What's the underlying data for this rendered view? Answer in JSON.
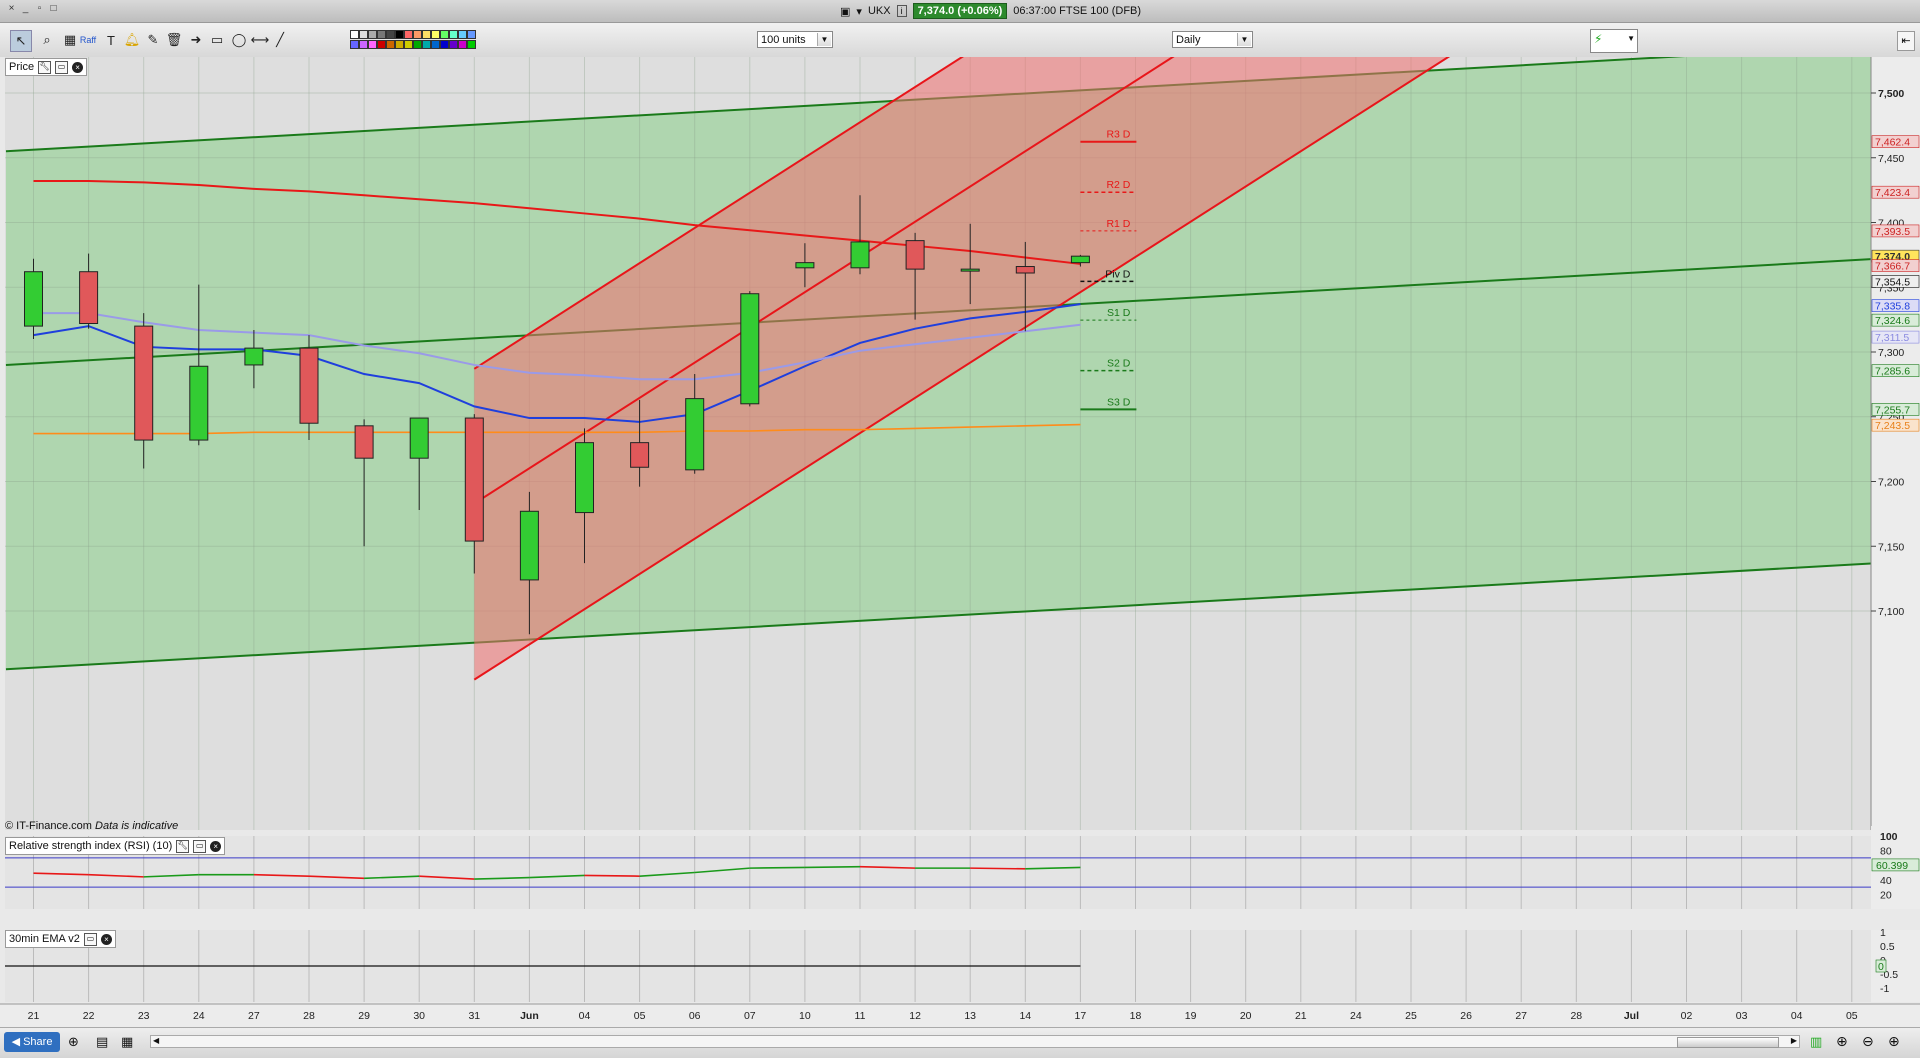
{
  "window": {
    "symbol": "UKX",
    "quote": "7,374.0 (+0.06%)",
    "time_instrument": "06:37:00 FTSE 100 (DFB)"
  },
  "toolbar": {
    "units_select": "100 units",
    "interval_select": "Daily"
  },
  "panels": {
    "price_label": "Price",
    "rsi_label": "Relative strength index (RSI) (10)",
    "ema_label": "30min EMA v2",
    "copyright": "© IT-Finance.com",
    "disclaimer": "Data is indicative"
  },
  "bottom": {
    "share_label": "Share"
  },
  "colors": {
    "bull": "#33cc33",
    "bear": "#e0585a",
    "channel_red": "#e8151a",
    "channel_green": "#1a7a1a",
    "sma_red": "#e81818",
    "ma_blue": "#1f3fdd",
    "ma_lavender": "#9a9ae8",
    "ma_orange": "#ff8c1a"
  },
  "chart_data": {
    "type": "candlestick",
    "x_labels": [
      "21",
      "22",
      "23",
      "24",
      "27",
      "28",
      "29",
      "30",
      "31",
      "Jun",
      "04",
      "05",
      "06",
      "07",
      "10",
      "11",
      "12",
      "13",
      "14",
      "17",
      "18",
      "19",
      "20",
      "21",
      "24",
      "25",
      "26",
      "27",
      "28",
      "Jul",
      "02",
      "03",
      "04",
      "05"
    ],
    "y_ticks": [
      7100,
      7150,
      7200,
      7250,
      7300,
      7350,
      7400,
      7450,
      7500
    ],
    "ylim": [
      7040,
      7535
    ],
    "candles": [
      {
        "o": 7320,
        "h": 7372,
        "l": 7310,
        "c": 7362
      },
      {
        "o": 7362,
        "h": 7376,
        "l": 7318,
        "c": 7322
      },
      {
        "o": 7320,
        "h": 7330,
        "l": 7210,
        "c": 7232
      },
      {
        "o": 7232,
        "h": 7352,
        "l": 7228,
        "c": 7289
      },
      {
        "o": 7290,
        "h": 7317,
        "l": 7272,
        "c": 7303
      },
      {
        "o": 7303,
        "h": 7313,
        "l": 7232,
        "c": 7245
      },
      {
        "o": 7243,
        "h": 7248,
        "l": 7150,
        "c": 7218
      },
      {
        "o": 7218,
        "h": 7233,
        "l": 7178,
        "c": 7249
      },
      {
        "o": 7249,
        "h": 7252,
        "l": 7129,
        "c": 7154
      },
      {
        "o": 7124,
        "h": 7192,
        "l": 7082,
        "c": 7177
      },
      {
        "o": 7176,
        "h": 7241,
        "l": 7137,
        "c": 7230
      },
      {
        "o": 7230,
        "h": 7263,
        "l": 7196,
        "c": 7211
      },
      {
        "o": 7209,
        "h": 7283,
        "l": 7206,
        "c": 7264
      },
      {
        "o": 7260,
        "h": 7347,
        "l": 7258,
        "c": 7345
      },
      {
        "o": 7365,
        "h": 7384,
        "l": 7350,
        "c": 7369
      },
      {
        "o": 7365,
        "h": 7421,
        "l": 7360,
        "c": 7385
      },
      {
        "o": 7386,
        "h": 7392,
        "l": 7325,
        "c": 7364
      },
      {
        "o": 7364,
        "h": 7399,
        "l": 7337,
        "c": 7364
      },
      {
        "o": 7366,
        "h": 7385,
        "l": 7316,
        "c": 7361
      },
      {
        "o": 7369,
        "h": 7375,
        "l": 7366,
        "c": 7374
      }
    ],
    "lines": [
      {
        "name": "sma_red",
        "values": [
          7432,
          7432,
          7431,
          7429,
          7426,
          7424,
          7421,
          7418,
          7415,
          7411,
          7407,
          7403,
          7398,
          7394,
          7390,
          7386,
          7382,
          7378,
          7373,
          7368
        ]
      },
      {
        "name": "ma_blue",
        "values": [
          7313,
          7320,
          7304,
          7302,
          7302,
          7297,
          7283,
          7276,
          7258,
          7249,
          7249,
          7246,
          7252,
          7270,
          7289,
          7307,
          7318,
          7326,
          7331,
          7337
        ]
      },
      {
        "name": "ma_lavender",
        "values": [
          7330,
          7330,
          7323,
          7317,
          7315,
          7313,
          7305,
          7299,
          7290,
          7284,
          7282,
          7279,
          7279,
          7284,
          7292,
          7301,
          7306,
          7311,
          7316,
          7321
        ]
      },
      {
        "name": "ma_orange",
        "values": [
          7237,
          7237,
          7237,
          7237,
          7238,
          7238,
          7238,
          7238,
          7238,
          7238,
          7238,
          7238,
          7239,
          7239,
          7240,
          7240,
          7241,
          7242,
          7243,
          7244
        ]
      }
    ],
    "pivots": [
      {
        "label": "R3 D",
        "value": 7462.4
      },
      {
        "label": "R2 D",
        "value": 7423.4
      },
      {
        "label": "R1 D",
        "value": 7393.5
      },
      {
        "label": "Piv D",
        "value": 7354.5
      },
      {
        "label": "S1 D",
        "value": 7324.6
      },
      {
        "label": "S2 D",
        "value": 7285.6
      },
      {
        "label": "S3 D",
        "value": 7255.7
      }
    ],
    "price_badges": [
      {
        "text": "7,462.4",
        "value": 7462.4,
        "kind": "red"
      },
      {
        "text": "7,423.4",
        "value": 7423.4,
        "kind": "red"
      },
      {
        "text": "7,393.5",
        "value": 7393.5,
        "kind": "red"
      },
      {
        "text": "7,374.0",
        "value": 7374.0,
        "kind": "last"
      },
      {
        "text": "7,366.7",
        "value": 7366.7,
        "kind": "red"
      },
      {
        "text": "7,354.5",
        "value": 7354.5,
        "kind": "black"
      },
      {
        "text": "7,335.8",
        "value": 7335.8,
        "kind": "blue"
      },
      {
        "text": "7,324.6",
        "value": 7324.6,
        "kind": "green"
      },
      {
        "text": "7,311.5",
        "value": 7311.5,
        "kind": "lavender"
      },
      {
        "text": "7,285.6",
        "value": 7285.6,
        "kind": "green"
      },
      {
        "text": "7,255.7",
        "value": 7255.7,
        "kind": "green"
      },
      {
        "text": "7,243.5",
        "value": 7243.5,
        "kind": "orange"
      }
    ],
    "rsi": {
      "ticks": [
        100,
        80,
        60,
        40,
        20
      ],
      "last_text": "60.399",
      "values": [
        49,
        47,
        44,
        47,
        47,
        45,
        42,
        45,
        41,
        43,
        46,
        45,
        50,
        56,
        57,
        58,
        56,
        56,
        55,
        57
      ]
    },
    "ema": {
      "ticks": [
        "1",
        "0.5",
        "0",
        "-0.5",
        "-1"
      ],
      "last_text": "0"
    }
  }
}
